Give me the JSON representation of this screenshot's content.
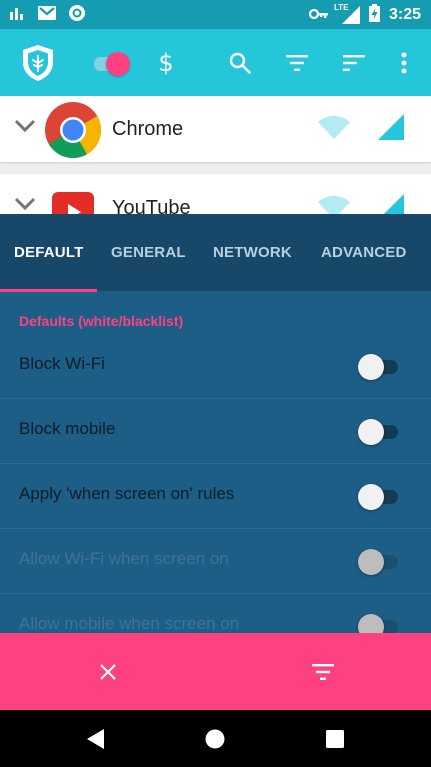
{
  "status_bar": {
    "time": "3:25",
    "network_label": "LTE",
    "icons": [
      "signal-bars-icon",
      "gmail-icon",
      "sync-icon",
      "vpn-key-icon",
      "lte-signal-icon",
      "battery-charging-icon"
    ]
  },
  "toolbar": {
    "icons": [
      "netguard-shield-icon",
      "toggle-switch",
      "dollar-icon",
      "search-icon",
      "filter-icon",
      "sort-icon",
      "overflow-menu-icon"
    ],
    "dollar_label": "$",
    "enabled": true
  },
  "apps": [
    {
      "name": "Chrome",
      "icon": "chrome-icon"
    },
    {
      "name": "YouTube",
      "icon": "youtube-icon"
    }
  ],
  "tabs": [
    {
      "label": "DEFAULT",
      "active": true
    },
    {
      "label": "GENERAL",
      "active": false
    },
    {
      "label": "NETWORK",
      "active": false
    },
    {
      "label": "ADVANCED",
      "active": false
    }
  ],
  "section_title": "Defaults (white/blacklist)",
  "settings": [
    {
      "label": "Block Wi-Fi",
      "enabled": true,
      "checked": false
    },
    {
      "label": "Block mobile",
      "enabled": true,
      "checked": false
    },
    {
      "label": "Apply 'when screen on' rules",
      "enabled": true,
      "checked": false
    },
    {
      "label": "Allow Wi-Fi when screen on",
      "enabled": false,
      "checked": false
    },
    {
      "label": "Allow mobile when screen on",
      "enabled": false,
      "checked": false
    }
  ],
  "action_bar": {
    "icons": [
      "close-icon",
      "filter-icon"
    ]
  },
  "nav_bar": {
    "icons": [
      "back-icon",
      "home-icon",
      "recents-icon"
    ]
  },
  "colors": {
    "primary": "#26c6da",
    "primary_dark": "#159cb0",
    "accent": "#ff4081",
    "sheet": "#1d5e87",
    "tabs": "#17486a"
  }
}
